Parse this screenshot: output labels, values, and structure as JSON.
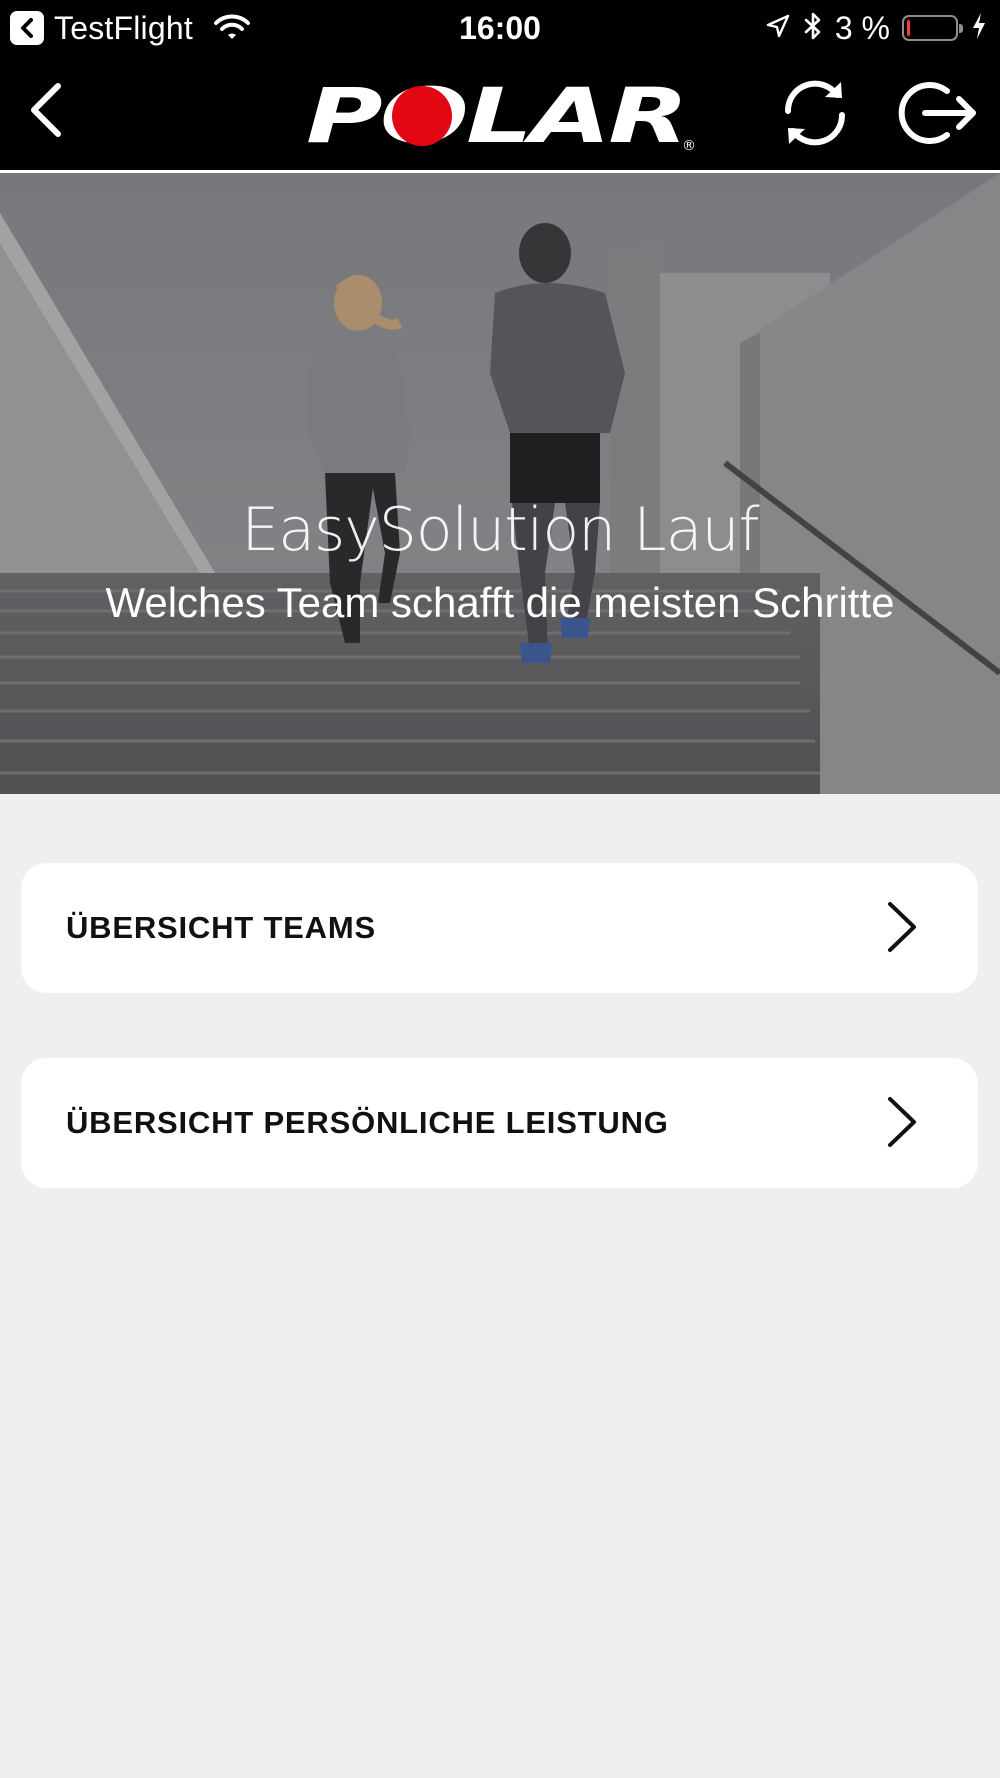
{
  "status_bar": {
    "carrier_label": "TestFlight",
    "time": "16:00",
    "battery_percent": "3 %",
    "battery_level": 0.03,
    "icons": [
      "back-to-app-icon",
      "wifi-icon",
      "location-arrow-icon",
      "bluetooth-icon",
      "battery-icon",
      "charging-bolt-icon"
    ]
  },
  "nav": {
    "logo_text": "POLAR",
    "logo_mark": "®",
    "icons": [
      "back-chevron-icon",
      "sync-icon",
      "logout-icon"
    ]
  },
  "hero": {
    "title": "EasySolution Lauf",
    "subtitle": "Welches Team schafft die meisten Schritte"
  },
  "menu": {
    "items": [
      {
        "label": "ÜBERSICHT TEAMS",
        "icon": "chevron-right-icon"
      },
      {
        "label": "ÜBERSICHT PERSÖNLICHE LEISTUNG",
        "icon": "chevron-right-icon"
      }
    ]
  },
  "colors": {
    "nav_background": "#000000",
    "page_background": "#efefef",
    "card_background": "#ffffff",
    "logo_accent": "#e30613"
  }
}
